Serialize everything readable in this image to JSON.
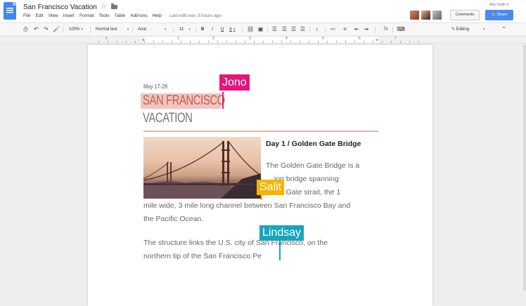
{
  "app": {
    "title": "San Francisco Vacation",
    "menu": [
      "File",
      "Edit",
      "View",
      "Insert",
      "Format",
      "Tools",
      "Table",
      "Add-ons",
      "Help"
    ],
    "last_edit": "Last edit was 3 hours ago",
    "user": "Ada Smith ▾",
    "comments_label": "Comments",
    "share_label": "Share"
  },
  "toolbar": {
    "zoom": "100%",
    "style": "Normal text",
    "font": "Arial",
    "size": "11",
    "bold": "B",
    "italic": "I",
    "underline": "U",
    "text_color": "A",
    "clear_format": "Tx",
    "mode": "Editing"
  },
  "ruler": {
    "numbers": [
      "1",
      "1",
      "2",
      "3",
      "4",
      "5",
      "6",
      "7"
    ]
  },
  "document": {
    "date": "May 17-28",
    "heading1": "SAN FRANCISCO",
    "heading2": "VACATION",
    "day_title": "Day 1 / Golden Gate Bridge",
    "lines_right": [
      "The Golden Gate Bridge is a",
      "ion bridge spanning",
      "en Gate strait, the 1"
    ],
    "lines_full": [
      "mile wide, 3 mile long channel between San Francisco Bay and",
      "the Pacific Ocean."
    ],
    "para2": [
      "The structure links the U.S. city of San Francisco, on the",
      "northern tip of the San Francisco Pe"
    ]
  },
  "collaborators": [
    {
      "name": "Jono",
      "color": "#e6157a"
    },
    {
      "name": "Salit",
      "color": "#f4b400"
    },
    {
      "name": "Lindsay",
      "color": "#17a5c0"
    }
  ],
  "icons": [
    "docs-logo-icon",
    "star-icon",
    "folder-icon",
    "print-icon",
    "undo-icon",
    "redo-icon",
    "paint-format-icon",
    "link-icon",
    "comment-icon",
    "align-left-icon",
    "align-center-icon",
    "align-right-icon",
    "justify-icon",
    "line-spacing-icon",
    "numbered-list-icon",
    "bulleted-list-icon",
    "indent-decrease-icon",
    "indent-increase-icon",
    "clear-format-icon",
    "input-tools-icon",
    "pencil-icon",
    "collapse-icon"
  ]
}
